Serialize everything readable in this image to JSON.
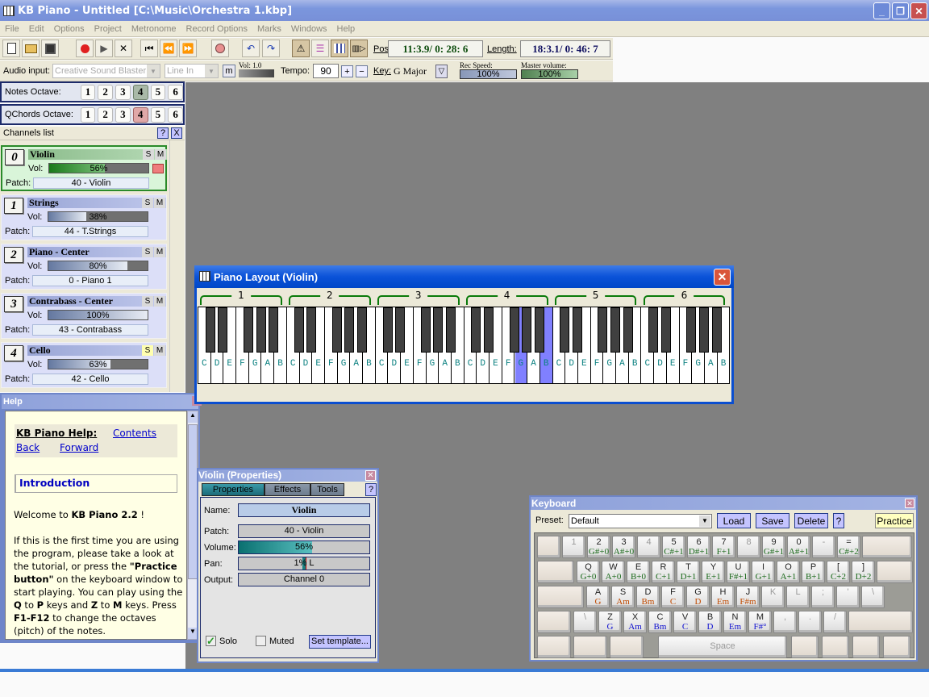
{
  "window": {
    "title": "KB Piano - Untitled [C:\\Music\\Orchestra 1.kbp]",
    "controls": [
      "minimize",
      "restore",
      "close"
    ]
  },
  "menu": [
    "File",
    "Edit",
    "Options",
    "Project",
    "Metronome",
    "Record Options",
    "Marks",
    "Windows",
    "Help"
  ],
  "toolbar": {
    "buttons": [
      "new-file",
      "open-folder",
      "save",
      "record",
      "play",
      "stop",
      "go-to-start",
      "rewind",
      "fast-forward",
      "metronome-knob",
      "undo",
      "redo",
      "metronome",
      "mixer",
      "piano-layout",
      "piano-play"
    ],
    "pos_label": "Pos:",
    "pos_value": "11:3.9/ 0: 28: 6",
    "length_label": "Length:",
    "length_value": "18:3.1/ 0: 46: 7"
  },
  "audio": {
    "label": "Audio input:",
    "device": "Creative Sound Blaster",
    "source": "Line In",
    "m_label": "m",
    "vol_label": "Vol: 1.0",
    "tempo_label": "Tempo:",
    "tempo_value": "90",
    "plus": "+",
    "minus": "−",
    "key_label": "Key:",
    "key_value": "G Major",
    "rec_speed_label": "Rec Speed:",
    "rec_speed_value": "100%",
    "master_volume_label": "Master volume:",
    "master_volume_value": "100%"
  },
  "notes_octave": {
    "label": "Notes Octave:",
    "options": [
      "1",
      "2",
      "3",
      "4",
      "5",
      "6"
    ],
    "selected": "4"
  },
  "qchords_octave": {
    "label": "QChords Octave:",
    "options": [
      "1",
      "2",
      "3",
      "4",
      "5",
      "6"
    ],
    "selected": "4"
  },
  "channels": {
    "title": "Channels list",
    "help": "?",
    "close": "X",
    "items": [
      {
        "num": "0",
        "name": "Violin",
        "vol": 56,
        "vol_text": "56%",
        "patch_label": "Patch:",
        "patch": "40 - Violin",
        "solo": false,
        "active": true
      },
      {
        "num": "1",
        "name": "Strings",
        "vol": 38,
        "vol_text": "38%",
        "patch_label": "Patch:",
        "patch": "44 - T.Strings",
        "solo": false,
        "active": false
      },
      {
        "num": "2",
        "name": "Piano - Center",
        "vol": 80,
        "vol_text": "80%",
        "patch_label": "Patch:",
        "patch": "0 - Piano 1",
        "solo": false,
        "active": false
      },
      {
        "num": "3",
        "name": "Contrabass - Center",
        "vol": 100,
        "vol_text": "100%",
        "patch_label": "Patch:",
        "patch": "43 - Contrabass",
        "solo": false,
        "active": false
      },
      {
        "num": "4",
        "name": "Cello",
        "vol": 63,
        "vol_text": "63%",
        "patch_label": "Patch:",
        "patch": "42 - Cello",
        "solo": true,
        "active": false
      }
    ],
    "vol_label": "Vol:",
    "s": "S",
    "m": "M"
  },
  "help": {
    "title": "Help",
    "heading": "KB Piano Help:",
    "contents": "Contents",
    "back": "Back",
    "forward": "Forward",
    "section": "Introduction",
    "welcome_pre": "Welcome to ",
    "welcome_bold": "KB Piano 2.2",
    "welcome_post": " !",
    "p1": "If this is the first time you are using the program, please take a look at the tutorial, or press the ",
    "p1_bold": "\"Practice button\"",
    "p2": " on the keyboard window to start playing. You can play using the ",
    "q": "Q",
    "to": " to ",
    "p": "P",
    "keys_and": " keys and ",
    "z": "Z",
    "m": "M",
    "keys_end": " keys. Press ",
    "f": "F1-F12",
    "p3": " to change the octaves (pitch) of the notes."
  },
  "piano": {
    "title": "Piano Layout (Violin)",
    "octaves": [
      "1",
      "2",
      "3",
      "4",
      "5",
      "6"
    ],
    "white_notes": [
      "C",
      "D",
      "E",
      "F",
      "G",
      "A",
      "B"
    ],
    "highlighted": [
      {
        "octave": 4,
        "note": "G"
      },
      {
        "octave": 4,
        "note": "B"
      }
    ]
  },
  "properties": {
    "title": "Violin (Properties)",
    "tabs": [
      "Properties",
      "Effects",
      "Tools"
    ],
    "help": "?",
    "name_label": "Name:",
    "name_value": "Violin",
    "patch_label": "Patch:",
    "patch_value": "40 - Violin",
    "volume_label": "Volume:",
    "volume_value": 56,
    "volume_text": "56%",
    "pan_label": "Pan:",
    "pan_text": "1% L",
    "output_label": "Output:",
    "output_value": "Channel 0",
    "solo_label": "Solo",
    "solo_checked": true,
    "muted_label": "Muted",
    "muted_checked": false,
    "template_button": "Set template..."
  },
  "keyboard": {
    "title": "Keyboard",
    "preset_label": "Preset:",
    "preset_value": "Default",
    "load": "Load",
    "save": "Save",
    "delete": "Delete",
    "help": "?",
    "practice": "Practice",
    "row1": [
      {
        "t": "",
        "b": ""
      },
      {
        "t": "1",
        "b": ""
      },
      {
        "t": "2",
        "b": "G#+0"
      },
      {
        "t": "3",
        "b": "A#+0"
      },
      {
        "t": "4",
        "b": ""
      },
      {
        "t": "5",
        "b": "C#+1"
      },
      {
        "t": "6",
        "b": "D#+1"
      },
      {
        "t": "7",
        "b": "F+1"
      },
      {
        "t": "8",
        "b": ""
      },
      {
        "t": "9",
        "b": "G#+1"
      },
      {
        "t": "0",
        "b": "A#+1"
      },
      {
        "t": "-",
        "b": ""
      },
      {
        "t": "=",
        "b": "C#+2"
      }
    ],
    "row2": [
      {
        "t": "Q",
        "b": "G+0"
      },
      {
        "t": "W",
        "b": "A+0"
      },
      {
        "t": "E",
        "b": "B+0"
      },
      {
        "t": "R",
        "b": "C+1"
      },
      {
        "t": "T",
        "b": "D+1"
      },
      {
        "t": "Y",
        "b": "E+1"
      },
      {
        "t": "U",
        "b": "F#+1"
      },
      {
        "t": "I",
        "b": "G+1"
      },
      {
        "t": "O",
        "b": "A+1"
      },
      {
        "t": "P",
        "b": "B+1"
      },
      {
        "t": "[",
        "b": "C+2"
      },
      {
        "t": "]",
        "b": "D+2"
      }
    ],
    "row3": [
      {
        "t": "A",
        "b": "G"
      },
      {
        "t": "S",
        "b": "Am"
      },
      {
        "t": "D",
        "b": "Bm"
      },
      {
        "t": "F",
        "b": "C"
      },
      {
        "t": "G",
        "b": "D"
      },
      {
        "t": "H",
        "b": "Em"
      },
      {
        "t": "J",
        "b": "F#m"
      },
      {
        "t": "K",
        "b": ""
      },
      {
        "t": "L",
        "b": ""
      },
      {
        "t": ";",
        "b": ""
      },
      {
        "t": "'",
        "b": ""
      },
      {
        "t": "\\",
        "b": ""
      }
    ],
    "row4": [
      {
        "t": "\\",
        "b": ""
      },
      {
        "t": "Z",
        "b": "G"
      },
      {
        "t": "X",
        "b": "Am"
      },
      {
        "t": "C",
        "b": "Bm"
      },
      {
        "t": "V",
        "b": "C"
      },
      {
        "t": "B",
        "b": "D"
      },
      {
        "t": "N",
        "b": "Em"
      },
      {
        "t": "M",
        "b": "F#°"
      },
      {
        "t": ",",
        "b": ""
      },
      {
        "t": ".",
        "b": ""
      },
      {
        "t": "/",
        "b": ""
      }
    ],
    "space": "Space"
  }
}
